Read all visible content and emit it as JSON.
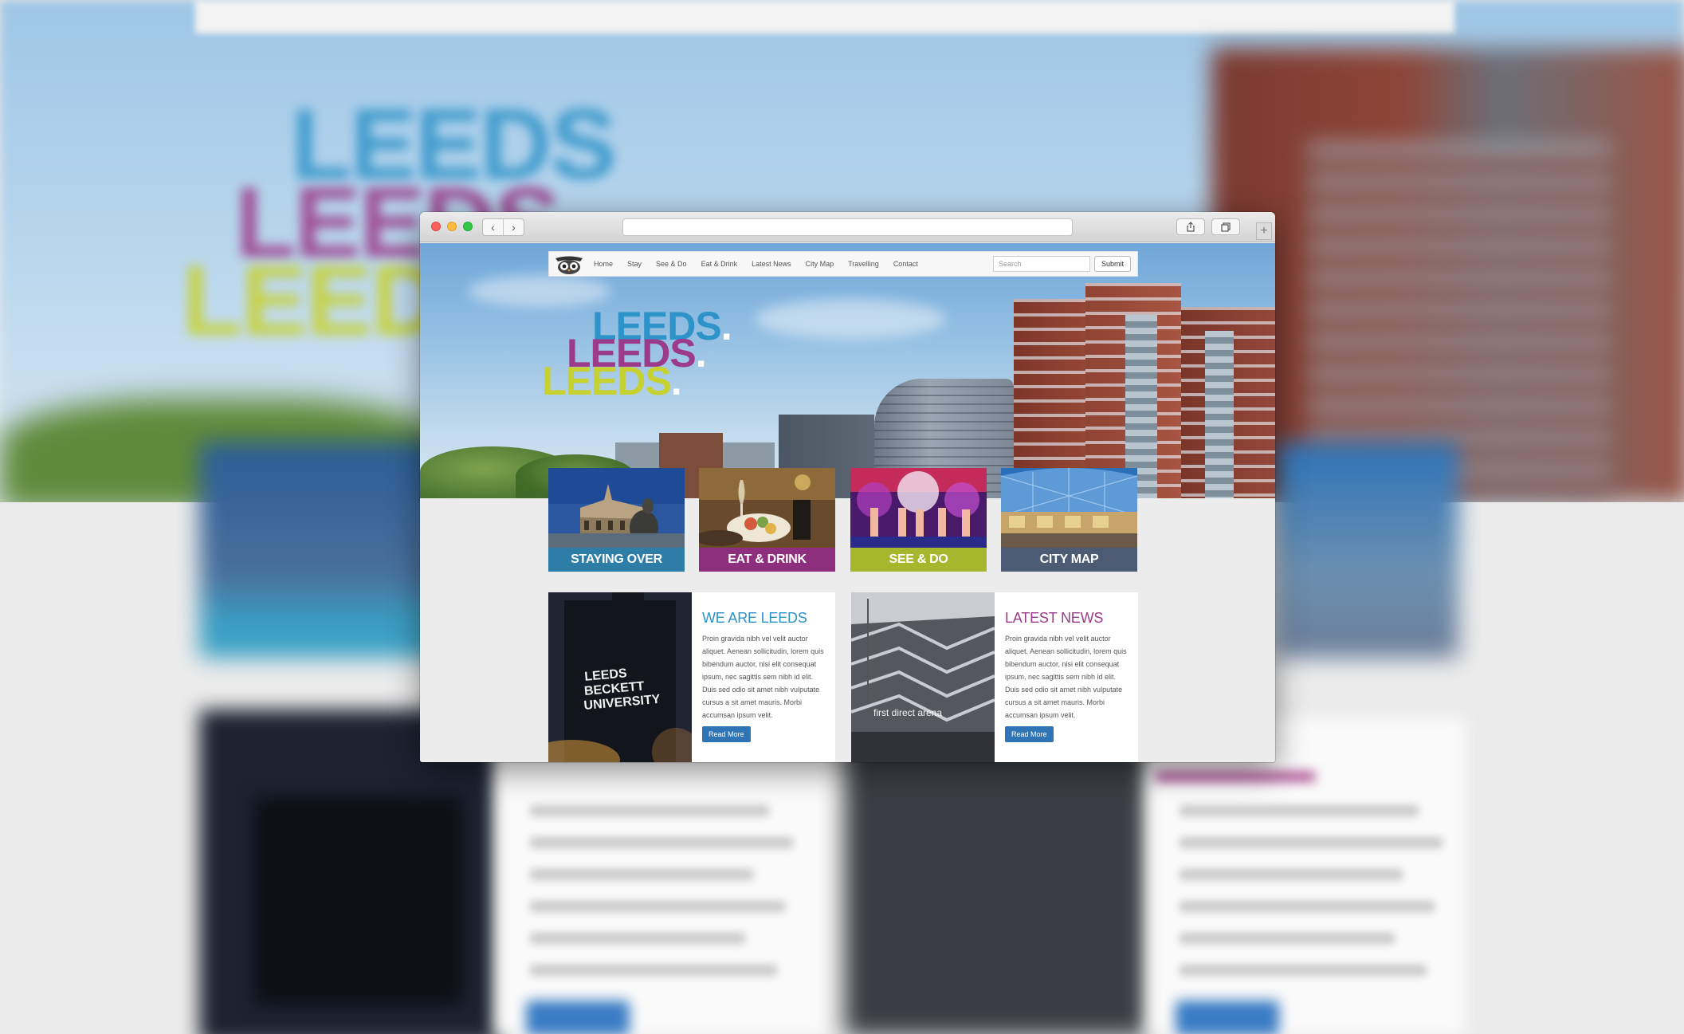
{
  "background_leeds": [
    "LEEDS",
    "LEEDS",
    "LEEDS"
  ],
  "browser": {
    "back_glyph": "‹",
    "forward_glyph": "›",
    "new_tab_glyph": "+"
  },
  "site": {
    "nav": {
      "items": [
        "Home",
        "Stay",
        "See & Do",
        "Eat & Drink",
        "Latest News",
        "City Map",
        "Travelling",
        "Contact"
      ],
      "search_placeholder": "Search",
      "submit_label": "Submit"
    },
    "hero": {
      "words": [
        {
          "text": "LEEDS",
          "dot": ".",
          "color": "#2e93c9"
        },
        {
          "text": "LEEDS",
          "dot": ".",
          "color": "#9c3b8a"
        },
        {
          "text": "LEEDS",
          "dot": ".",
          "color": "#c7d12f"
        }
      ]
    },
    "tiles": [
      {
        "label": "STAYING OVER",
        "color": "#2e7da6"
      },
      {
        "label": "EAT & DRINK",
        "color": "#8e2f7e"
      },
      {
        "label": "SEE & DO",
        "color": "#a6b72e"
      },
      {
        "label": "CITY MAP",
        "color": "#4c5a73"
      }
    ],
    "cards": [
      {
        "title": "WE ARE LEEDS",
        "title_color": "#2e93c9",
        "text": "Proin gravida nibh vel velit auctor aliquet. Aenean sollicitudin, lorem quis bibendum auctor, nisi elit consequat ipsum, nec sagittis sem nibh id elit. Duis sed odio sit amet nibh vulputate cursus a sit amet mauris. Morbi accumsan ipsum velit.",
        "button": "Read More",
        "image_text": "LEEDS BECKETT UNIVERSITY"
      },
      {
        "title": "LATEST NEWS",
        "title_color": "#9c3b8a",
        "text": "Proin gravida nibh vel velit auctor aliquet. Aenean sollicitudin, lorem quis bibendum auctor, nisi elit consequat ipsum, nec sagittis sem nibh id elit. Duis sed odio sit amet nibh vulputate cursus a sit amet mauris. Morbi accumsan ipsum velit.",
        "button": "Read More",
        "image_text": "first direct arena"
      }
    ]
  }
}
